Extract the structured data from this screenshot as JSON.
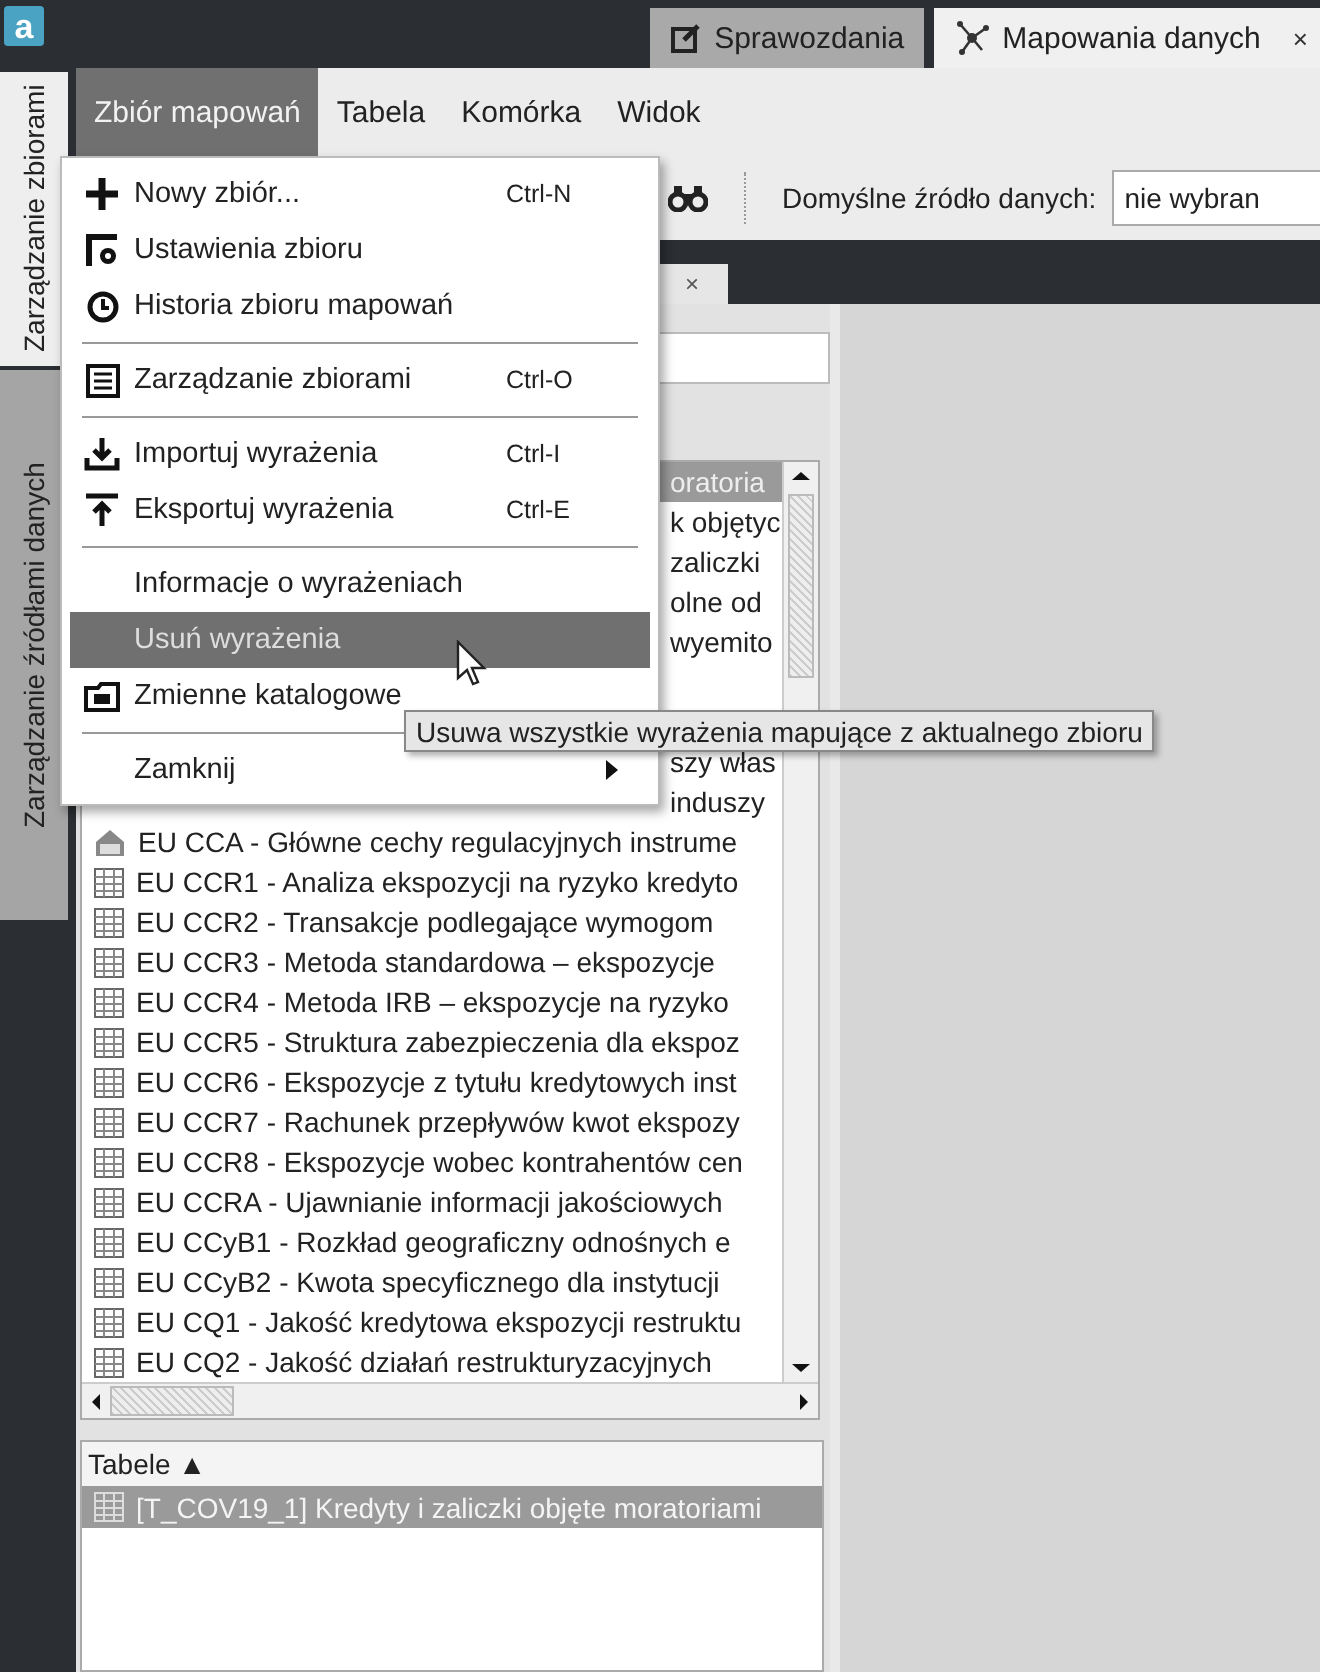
{
  "app_logo": "a",
  "tabs": [
    {
      "label": "Sprawozdania",
      "selected": false
    },
    {
      "label": "Mapowania danych",
      "selected": true,
      "close": "×"
    }
  ],
  "side_tabs": [
    {
      "label": "Zarządzanie zbiorami",
      "selected": true
    },
    {
      "label": "Zarządzanie źródłami danych",
      "selected": false
    }
  ],
  "menu_bar": [
    {
      "label": "Zbiór mapowań",
      "selected": true
    },
    {
      "label": "Tabela",
      "selected": false
    },
    {
      "label": "Komórka",
      "selected": false
    },
    {
      "label": "Widok",
      "selected": false
    }
  ],
  "toolbar": {
    "source_label": "Domyślne źródło danych:",
    "source_value": "nie wybran"
  },
  "document_tab": {
    "close": "×"
  },
  "list": {
    "rows": [
      {
        "kind": "partial",
        "text": "oratoria",
        "selected": true
      },
      {
        "kind": "partial",
        "text": "k objętyc",
        "selected": false
      },
      {
        "kind": "partial",
        "text": "zaliczki",
        "selected": false
      },
      {
        "kind": "partial",
        "text": "olne od",
        "selected": false
      },
      {
        "kind": "partial",
        "text": "wyemito",
        "selected": false
      },
      {
        "kind": "hidden",
        "selected": false
      },
      {
        "kind": "hidden",
        "selected": false
      },
      {
        "kind": "partial",
        "text": "szy włas",
        "selected": false
      },
      {
        "kind": "partial",
        "text": "induszy",
        "selected": false
      },
      {
        "kind": "group",
        "text": "EU CCA - Główne cechy regulacyjnych instrume",
        "selected": false
      },
      {
        "kind": "table",
        "text": "EU CCR1 - Analiza ekspozycji na ryzyko kredyto",
        "selected": false
      },
      {
        "kind": "table",
        "text": "EU CCR2 - Transakcje podlegające wymogom",
        "selected": false
      },
      {
        "kind": "table",
        "text": "EU CCR3 - Metoda standardowa – ekspozycje",
        "selected": false
      },
      {
        "kind": "table",
        "text": "EU CCR4 - Metoda IRB – ekspozycje na ryzyko",
        "selected": false
      },
      {
        "kind": "table",
        "text": "EU CCR5 - Struktura zabezpieczenia dla ekspoz",
        "selected": false
      },
      {
        "kind": "table",
        "text": "EU CCR6 - Ekspozycje z tytułu kredytowych inst",
        "selected": false
      },
      {
        "kind": "table",
        "text": "EU CCR7 - Rachunek przepływów kwot ekspozy",
        "selected": false
      },
      {
        "kind": "table",
        "text": "EU CCR8 - Ekspozycje wobec kontrahentów cen",
        "selected": false
      },
      {
        "kind": "table",
        "text": "EU CCRA - Ujawnianie informacji jakościowych",
        "selected": false
      },
      {
        "kind": "table",
        "text": "EU CCyB1 - Rozkład geograficzny odnośnych e",
        "selected": false
      },
      {
        "kind": "table",
        "text": "EU CCyB2 - Kwota specyficznego dla instytucji",
        "selected": false
      },
      {
        "kind": "table",
        "text": "EU CQ1 - Jakość kredytowa ekspozycji restruktu",
        "selected": false
      },
      {
        "kind": "table",
        "text": "EU CQ2 - Jakość działań restrukturyzacyjnych",
        "selected": false
      }
    ]
  },
  "tables_panel": {
    "header": "Tabele ▲",
    "rows": [
      {
        "text": "[T_COV19_1] Kredyty i zaliczki objęte moratoriami",
        "selected": true
      }
    ]
  },
  "menu": [
    {
      "kind": "item",
      "label": "Nowy zbiór...",
      "shortcut": "Ctrl-N",
      "selected": false
    },
    {
      "kind": "item",
      "label": "Ustawienia zbioru",
      "selected": false
    },
    {
      "kind": "item",
      "label": "Historia zbioru mapowań",
      "selected": false
    },
    {
      "kind": "separator"
    },
    {
      "kind": "item",
      "label": "Zarządzanie zbiorami",
      "shortcut": "Ctrl-O",
      "selected": false
    },
    {
      "kind": "separator"
    },
    {
      "kind": "item",
      "label": "Importuj wyrażenia",
      "shortcut": "Ctrl-I",
      "selected": false
    },
    {
      "kind": "item",
      "label": "Eksportuj wyrażenia",
      "shortcut": "Ctrl-E",
      "selected": false
    },
    {
      "kind": "separator"
    },
    {
      "kind": "item",
      "label": "Informacje o wyrażeniach",
      "selected": false
    },
    {
      "kind": "item",
      "label": "Usuń wyrażenia",
      "selected": true
    },
    {
      "kind": "item",
      "label": "Zmienne katalogowe",
      "selected": false
    },
    {
      "kind": "separator"
    },
    {
      "kind": "item",
      "label": "Zamknij",
      "submenu": true,
      "selected": false
    }
  ],
  "tooltip": "Usuwa wszystkie wyrażenia mapujące z aktualnego zbioru"
}
